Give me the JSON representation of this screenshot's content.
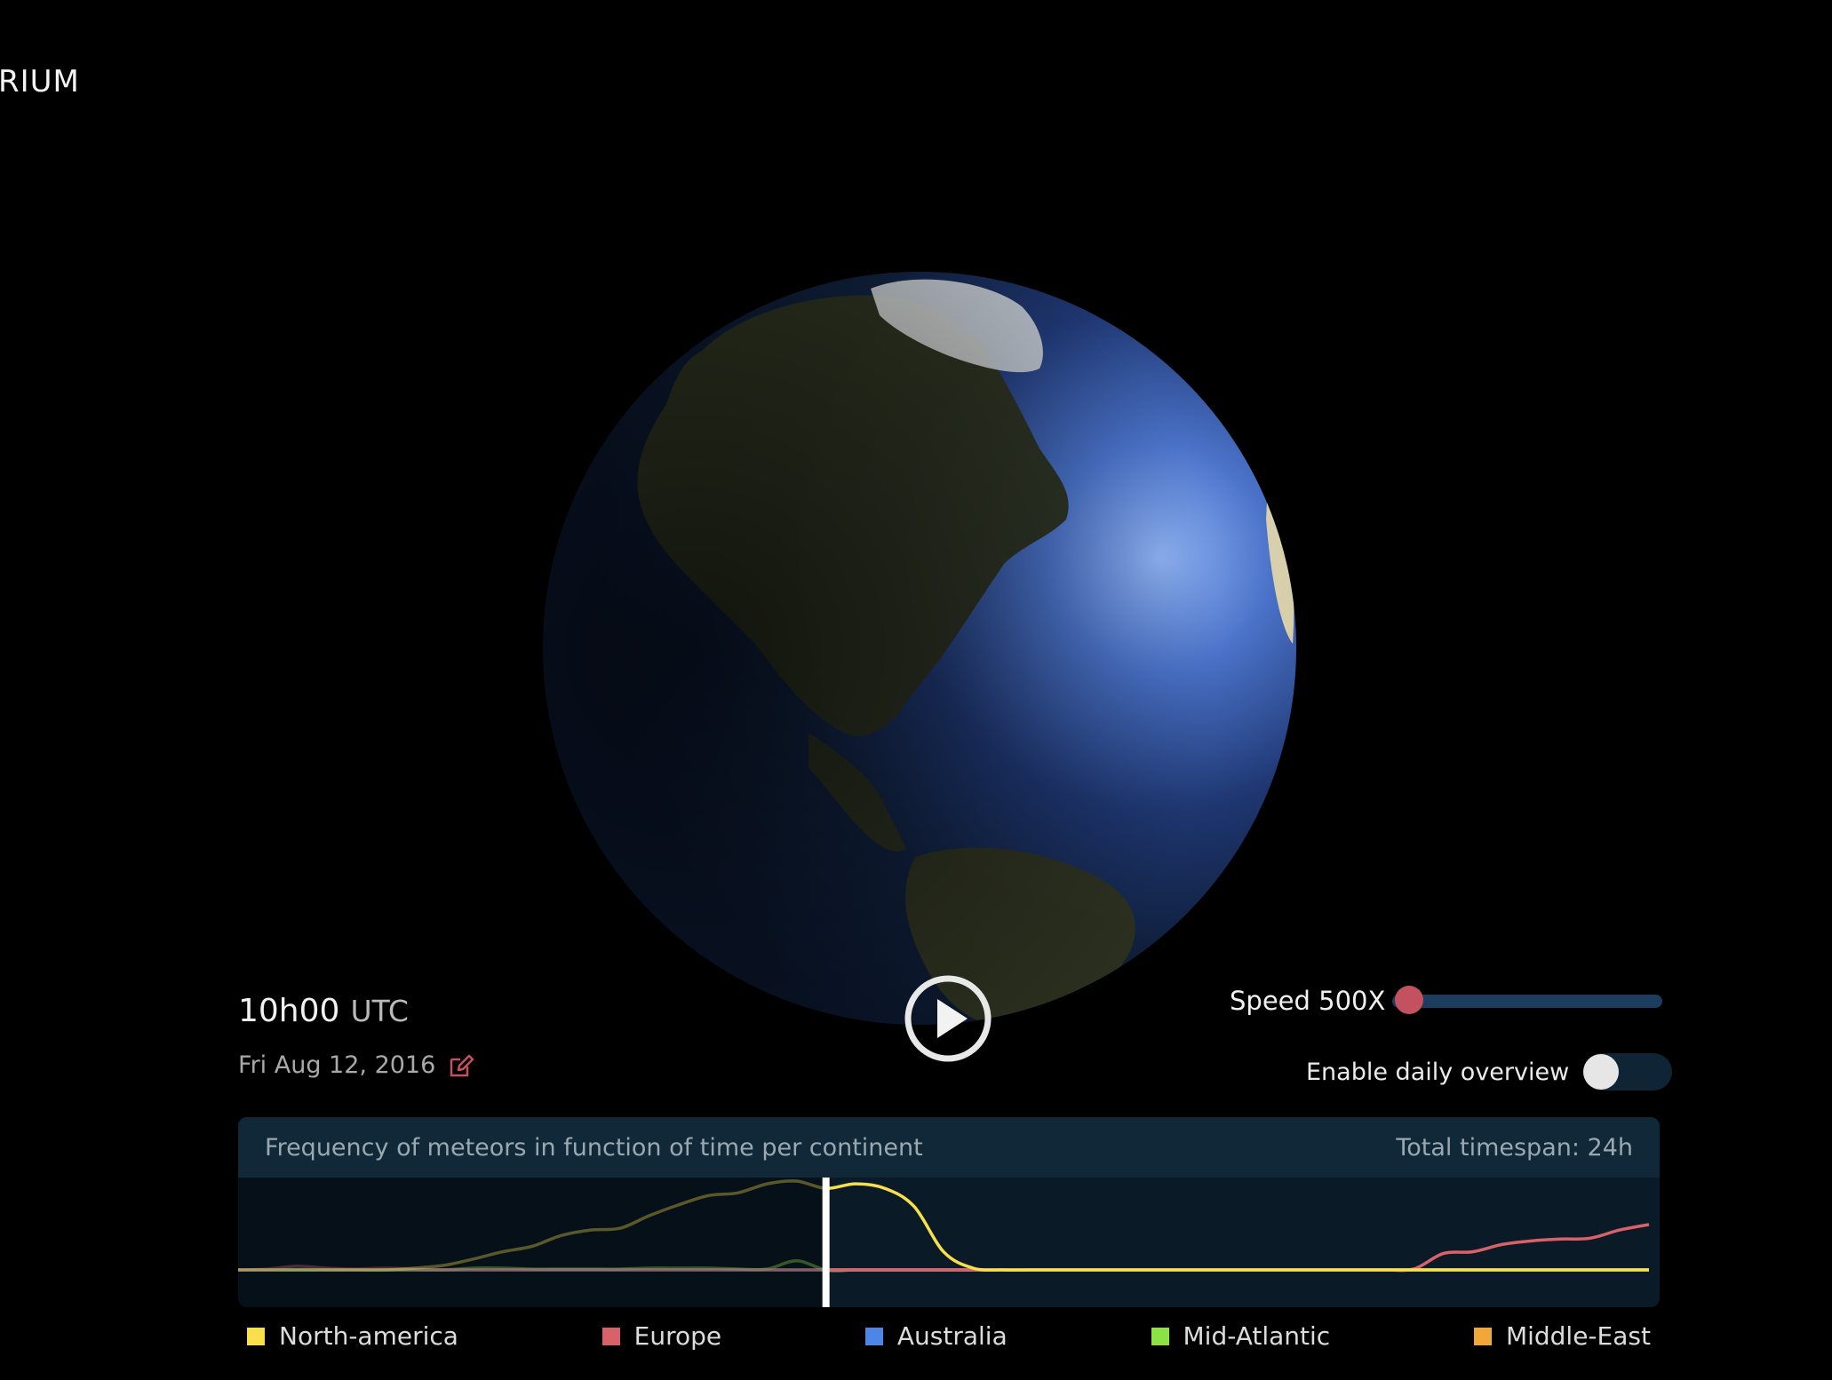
{
  "app": {
    "title_fragment": "RIUM"
  },
  "clock": {
    "time": "10h00",
    "zone": "UTC",
    "date": "Fri Aug 12, 2016"
  },
  "controls": {
    "speed_label": "Speed 500X",
    "speed_level": 0.06,
    "overview_label": "Enable daily overview",
    "overview_enabled": false
  },
  "icons": {
    "edit": "edit-icon",
    "play": "play-icon",
    "globe": "earth-globe"
  },
  "colors": {
    "accent": "#c4515f",
    "track": "#1c3d5d",
    "panel": "#0a1a26",
    "panel_header": "#102838"
  },
  "chart_data": {
    "type": "area",
    "title": "Frequency of meteors in function of time per continent",
    "timespan_label": "Total timespan: 24h",
    "x_unit": "hour",
    "xlim": [
      0,
      24
    ],
    "ylim": [
      0,
      1
    ],
    "current_time": 10,
    "grid": false,
    "legend": "bottom",
    "x": [
      0,
      0.5,
      1,
      1.5,
      2,
      2.5,
      3,
      3.5,
      4,
      4.5,
      5,
      5.5,
      6,
      6.5,
      7,
      7.5,
      8,
      8.5,
      9,
      9.5,
      10,
      10.5,
      11,
      11.5,
      12,
      12.5,
      13,
      13.5,
      14,
      14.5,
      15,
      15.5,
      16,
      16.5,
      17,
      17.5,
      18,
      18.5,
      19,
      19.5,
      20,
      20.5,
      21,
      21.5,
      22,
      22.5,
      23,
      23.5,
      24
    ],
    "series": [
      {
        "name": "North-america",
        "color": "#f8e04a",
        "values": [
          0,
          0,
          0,
          0,
          0,
          0,
          0.02,
          0.05,
          0.12,
          0.2,
          0.26,
          0.38,
          0.44,
          0.46,
          0.6,
          0.72,
          0.82,
          0.85,
          0.95,
          0.98,
          0.9,
          0.95,
          0.9,
          0.7,
          0.2,
          0.02,
          0,
          0,
          0,
          0,
          0,
          0,
          0,
          0,
          0,
          0,
          0,
          0,
          0,
          0,
          0,
          0,
          0,
          0,
          0,
          0,
          0,
          0,
          0
        ]
      },
      {
        "name": "Europe",
        "color": "#d9626a",
        "values": [
          0,
          0.01,
          0.04,
          0.02,
          0.01,
          0.02,
          0.01,
          0,
          0,
          0,
          0,
          0,
          0,
          0,
          0,
          0,
          0,
          0,
          0,
          0,
          0,
          0,
          0,
          0,
          0,
          0,
          0,
          0,
          0,
          0,
          0,
          0,
          0,
          0,
          0,
          0,
          0,
          0,
          0,
          0,
          0.01,
          0.18,
          0.2,
          0.28,
          0.32,
          0.34,
          0.35,
          0.44,
          0.5
        ]
      },
      {
        "name": "Australia",
        "color": "#4d86e8",
        "values": [
          0,
          0,
          0,
          0,
          0,
          0,
          0,
          0,
          0,
          0,
          0,
          0,
          0,
          0,
          0,
          0,
          0,
          0,
          0,
          0,
          0,
          0,
          0,
          0,
          0,
          0,
          0,
          0,
          0,
          0,
          0,
          0,
          0,
          0,
          0,
          0,
          0,
          0,
          0,
          0,
          0,
          0,
          0,
          0,
          0,
          0,
          0,
          0,
          0
        ]
      },
      {
        "name": "Mid-Atlantic",
        "color": "#8ce244",
        "values": [
          0,
          0,
          0,
          0,
          0,
          0,
          0,
          0,
          0.02,
          0.02,
          0.01,
          0.01,
          0.01,
          0.01,
          0.02,
          0.02,
          0.02,
          0.01,
          0.01,
          0.1,
          0,
          0,
          0,
          0,
          0,
          0,
          0,
          0,
          0,
          0,
          0,
          0,
          0,
          0,
          0,
          0,
          0,
          0,
          0,
          0,
          0,
          0,
          0,
          0,
          0,
          0,
          0,
          0,
          0
        ]
      },
      {
        "name": "Middle-East",
        "color": "#f2a838",
        "values": [
          0,
          0,
          0,
          0,
          0,
          0,
          0,
          0,
          0,
          0,
          0,
          0,
          0,
          0,
          0,
          0,
          0,
          0,
          0,
          0,
          0,
          0,
          0,
          0,
          0,
          0,
          0,
          0,
          0,
          0,
          0,
          0,
          0,
          0,
          0,
          0,
          0,
          0,
          0,
          0,
          0,
          0,
          0,
          0,
          0,
          0,
          0,
          0,
          0
        ]
      }
    ]
  }
}
